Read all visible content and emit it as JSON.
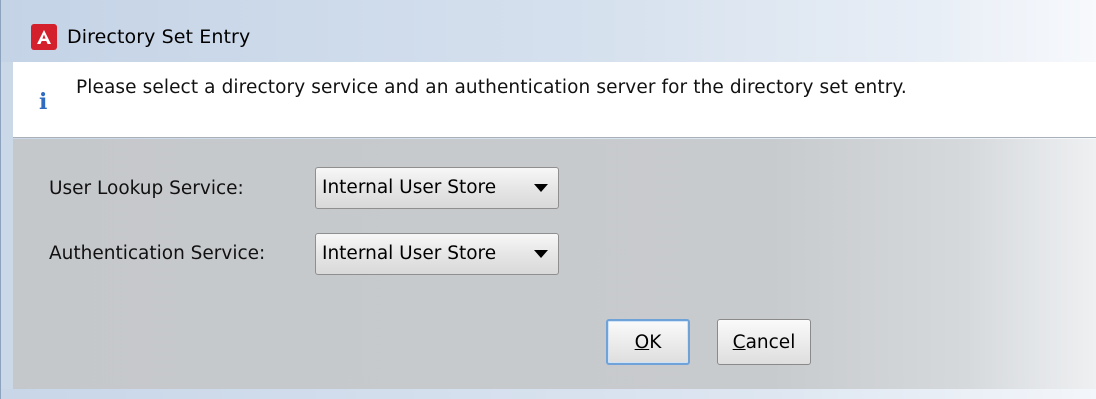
{
  "window": {
    "title": "Directory Set Entry",
    "icon": "app-logo-a-icon",
    "accent_color": "#d4202c"
  },
  "info": {
    "icon": "info-icon",
    "icon_glyph": "i",
    "message": "Please select a directory service and an authentication server for the directory set entry."
  },
  "form": {
    "user_lookup": {
      "label": "User Lookup Service:",
      "selected": "Internal User Store"
    },
    "authentication": {
      "label": "Authentication Service:",
      "selected": "Internal User Store"
    }
  },
  "buttons": {
    "ok": {
      "mnemonic": "O",
      "rest": "K"
    },
    "cancel": {
      "mnemonic": "C",
      "rest": "ancel"
    }
  }
}
